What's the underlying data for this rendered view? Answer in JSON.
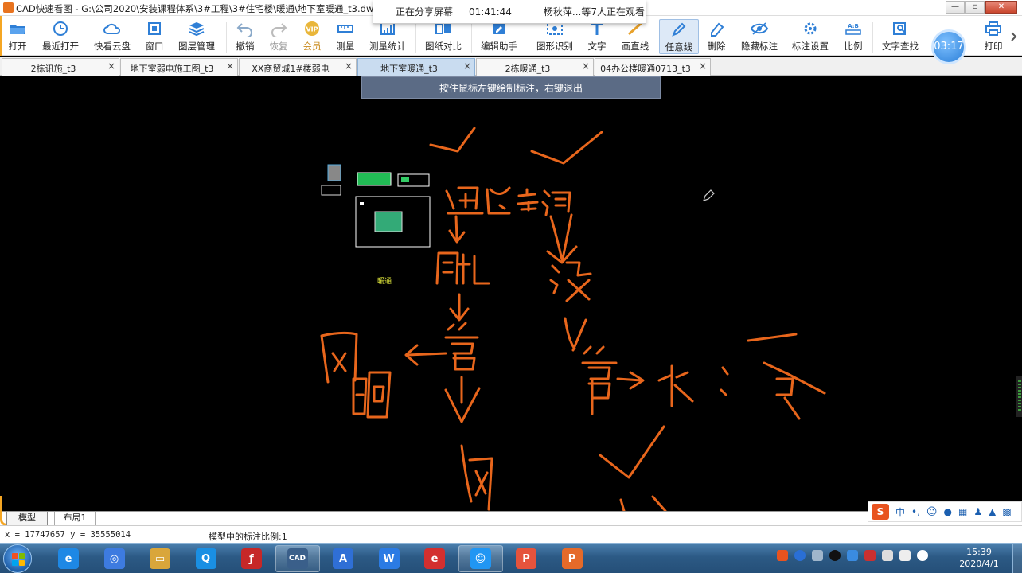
{
  "window": {
    "title": "CAD快速看图 - G:\\公司2020\\安装课程体系\\3#工程\\3#住宅楼\\暖通\\地下室暖通_t3.dwg",
    "controls": {
      "minimize": "—",
      "maximize": "▫",
      "close": "✕"
    }
  },
  "share_banner": {
    "status": "正在分享屏幕",
    "duration": "01:41:44",
    "viewers": "杨秋萍...等7人正在观看"
  },
  "toolbar": {
    "items": [
      {
        "label": "打开",
        "icon": "folder-open-icon"
      },
      {
        "label": "最近打开",
        "icon": "clock-icon"
      },
      {
        "label": "快看云盘",
        "icon": "cloud-icon"
      },
      {
        "label": "窗口",
        "icon": "window-icon"
      },
      {
        "label": "图层管理",
        "icon": "layers-icon"
      },
      {
        "label": "撤销",
        "icon": "undo-icon"
      },
      {
        "label": "恢复",
        "icon": "redo-icon"
      },
      {
        "label": "会员",
        "icon": "vip-icon"
      },
      {
        "label": "测量",
        "icon": "ruler-icon"
      },
      {
        "label": "测量统计",
        "icon": "measure-stats-icon"
      },
      {
        "label": "图纸对比",
        "icon": "compare-icon"
      },
      {
        "label": "编辑助手",
        "icon": "edit-assistant-icon"
      },
      {
        "label": "图形识别",
        "icon": "shape-recognition-icon"
      },
      {
        "label": "文字",
        "icon": "text-icon"
      },
      {
        "label": "画直线",
        "icon": "line-icon"
      },
      {
        "label": "任意线",
        "icon": "pencil-icon"
      },
      {
        "label": "删除",
        "icon": "eraser-icon"
      },
      {
        "label": "隐藏标注",
        "icon": "eye-icon"
      },
      {
        "label": "标注设置",
        "icon": "annotation-settings-icon"
      },
      {
        "label": "比例",
        "icon": "scale-icon"
      },
      {
        "label": "文字查找",
        "icon": "text-search-icon"
      },
      {
        "label": "打印",
        "icon": "printer-icon"
      }
    ],
    "timer": "03:17",
    "vip_badge": "VIP",
    "scale_badge": "A:B"
  },
  "tabs": [
    {
      "label": "2栋讯施_t3"
    },
    {
      "label": "地下室弱电施工图_t3"
    },
    {
      "label": "XX商贸城1#楼弱电"
    },
    {
      "label": "地下室暖通_t3",
      "active": true
    },
    {
      "label": "2栋暖通_t3"
    },
    {
      "label": "04办公楼暖通0713_t3"
    }
  ],
  "tab_close_glyph": "×",
  "hint": "按住鼠标左键绘制标注，右键退出",
  "canvas": {
    "annotation_color": "#e8661c",
    "thumbnail_label": "暖通"
  },
  "layout_tabs": [
    {
      "label": "模型",
      "active": true
    },
    {
      "label": "布局1"
    }
  ],
  "ime": {
    "logo": "S",
    "mode": "中",
    "punct": "•,"
  },
  "status": {
    "coords": "x = 17747657  y = 35555014",
    "scale_text": "模型中的标注比例:1"
  },
  "taskbar": {
    "apps": [
      {
        "name": "ie",
        "label": "e",
        "color": "#1e88e5"
      },
      {
        "name": "baidu-netdisk",
        "label": "◎",
        "color": "#3d7be0"
      },
      {
        "name": "file-explorer",
        "label": "▭",
        "color": "#d9a63b"
      },
      {
        "name": "qq-browser",
        "label": "Q",
        "color": "#1a8fe3"
      },
      {
        "name": "flash-player",
        "label": "ƒ",
        "color": "#c62828"
      },
      {
        "name": "cad-viewer",
        "label": "CAD",
        "color": "#3a5f8a",
        "running": true
      },
      {
        "name": "wps-text",
        "label": "A",
        "color": "#2f6fd6"
      },
      {
        "name": "wps-writer",
        "label": "W",
        "color": "#2b7be4"
      },
      {
        "name": "browser",
        "label": "e",
        "color": "#d32f2f"
      },
      {
        "name": "meeting",
        "label": "☺",
        "color": "#2196f3",
        "running": true
      },
      {
        "name": "wps-pdf",
        "label": "P",
        "color": "#e5533c"
      },
      {
        "name": "wps-presentation",
        "label": "P",
        "color": "#e56a2a"
      }
    ],
    "time": "15:39",
    "date": "2020/4/1"
  }
}
